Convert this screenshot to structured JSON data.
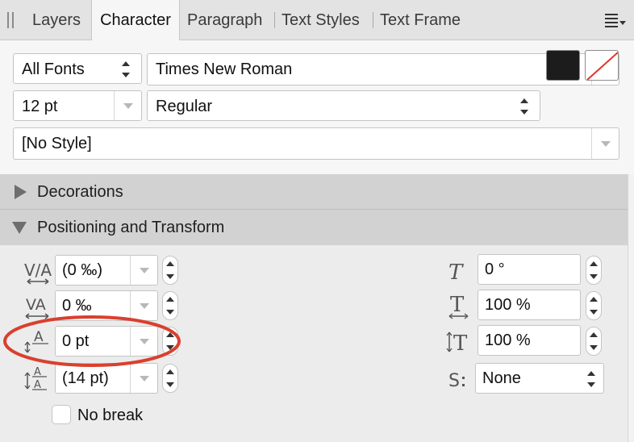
{
  "tabs": [
    {
      "label": "Layers",
      "active": false
    },
    {
      "label": "Character",
      "active": true
    },
    {
      "label": "Paragraph",
      "active": false
    },
    {
      "label": "Text Styles",
      "active": false
    },
    {
      "label": "Text Frame",
      "active": false
    }
  ],
  "font": {
    "collection": "All Fonts",
    "family": "Times New Roman",
    "size": "12 pt",
    "style": "Regular",
    "fill_color": "#1c1c1c",
    "stroke_color": "none"
  },
  "character_style": "[No Style]",
  "sections": {
    "decorations": "Decorations",
    "positioning": "Positioning and Transform"
  },
  "positioning": {
    "tracking": "(0 ‰)",
    "kerning": "0 ‰",
    "baseline_shift": "0 pt",
    "leading": "(14 pt)",
    "skew": "0 °",
    "horizontal_scale": "100 %",
    "vertical_scale": "100 %",
    "typographic_case": "None",
    "no_break_label": "No break",
    "no_break_checked": false
  },
  "colors": {
    "highlight_ellipse": "#d9402e",
    "active_tab_bg": "#f6f6f6",
    "section_header_bg": "#d2d2d2"
  }
}
